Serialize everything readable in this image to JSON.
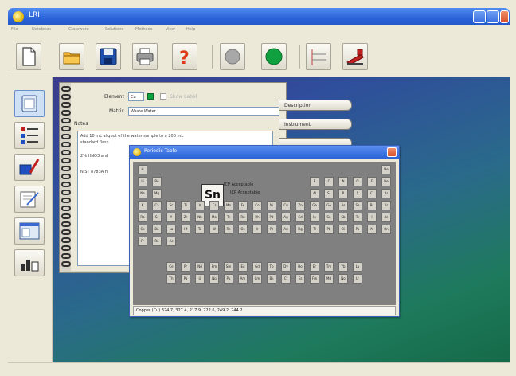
{
  "window": {
    "title": "LRI"
  },
  "menubar": [
    {
      "label": "File"
    },
    {
      "label": "Notebook"
    },
    {
      "label": "Glassware"
    },
    {
      "label": "Solutions"
    },
    {
      "label": "Methods"
    },
    {
      "label": "View"
    },
    {
      "label": "Help"
    }
  ],
  "toolbar": {
    "buttons": [
      {
        "icon": "new-document-icon"
      },
      {
        "icon": "open-folder-icon"
      },
      {
        "icon": "save-disk-icon"
      },
      {
        "icon": "printer-icon"
      },
      {
        "icon": "help-question-icon"
      },
      {
        "icon": "gray-light-icon"
      },
      {
        "icon": "green-light-icon"
      },
      {
        "icon": "notebook-lines-icon"
      },
      {
        "icon": "stapler-icon"
      }
    ]
  },
  "leftpanel": {
    "buttons": [
      {
        "icon": "notebook-icon"
      },
      {
        "icon": "list-icon"
      },
      {
        "icon": "flask-pipette-icon"
      },
      {
        "icon": "notepad-pencil-icon"
      },
      {
        "icon": "window-icon"
      },
      {
        "icon": "chart-icon"
      }
    ]
  },
  "notebook": {
    "element_label": "Element",
    "element_value": "Cu",
    "show_label": "Show Label",
    "matrix_label": "Matrix",
    "matrix_value": "Waste Water",
    "notes_label": "Notes",
    "notes_lines": [
      "Add 10 mL aliquot of the water sample to a 200 mL",
      "standard flask",
      "",
      "2% HNO3 and",
      "",
      "NIST 8783A fil"
    ]
  },
  "side_tabs": [
    {
      "label": "Description"
    },
    {
      "label": "Instrument"
    }
  ],
  "periodic_dialog": {
    "title": "Periodic Table",
    "selected_symbol": "Sn",
    "selected_info": [
      "ICP Acceptable",
      "ICP Acceptable"
    ],
    "status_text": "Copper (Cu) 324.7, 327.4, 217.9, 222.6, 249.2, 244.2",
    "rows": [
      [
        "H",
        "",
        "",
        "",
        "",
        "",
        "",
        "",
        "",
        "",
        "",
        "",
        "",
        "",
        "",
        "",
        "",
        "He"
      ],
      [
        "Li",
        "Be",
        "",
        "",
        "",
        "",
        "",
        "",
        "",
        "",
        "",
        "",
        "B",
        "C",
        "N",
        "O",
        "F",
        "Ne"
      ],
      [
        "Na",
        "Mg",
        "",
        "",
        "",
        "",
        "",
        "",
        "",
        "",
        "",
        "",
        "Al",
        "Si",
        "P",
        "S",
        "Cl",
        "Ar"
      ],
      [
        "K",
        "Ca",
        "Sc",
        "Ti",
        "V",
        "Cr",
        "Mn",
        "Fe",
        "Co",
        "Ni",
        "Cu",
        "Zn",
        "Ga",
        "Ge",
        "As",
        "Se",
        "Br",
        "Kr"
      ],
      [
        "Rb",
        "Sr",
        "Y",
        "Zr",
        "Nb",
        "Mo",
        "Tc",
        "Ru",
        "Rh",
        "Pd",
        "Ag",
        "Cd",
        "In",
        "Sn",
        "Sb",
        "Te",
        "I",
        "Xe"
      ],
      [
        "Cs",
        "Ba",
        "La",
        "Hf",
        "Ta",
        "W",
        "Re",
        "Os",
        "Ir",
        "Pt",
        "Au",
        "Hg",
        "Tl",
        "Pb",
        "Bi",
        "Po",
        "At",
        "Rn"
      ],
      [
        "Fr",
        "Ra",
        "Ac",
        "",
        "",
        "",
        "",
        "",
        "",
        "",
        "",
        "",
        "",
        "",
        "",
        "",
        "",
        ""
      ]
    ],
    "lanthanides": [
      "Ce",
      "Pr",
      "Nd",
      "Pm",
      "Sm",
      "Eu",
      "Gd",
      "Tb",
      "Dy",
      "Ho",
      "Er",
      "Tm",
      "Yb",
      "Lu"
    ],
    "actinides": [
      "Th",
      "Pa",
      "U",
      "Np",
      "Pu",
      "Am",
      "Cm",
      "Bk",
      "Cf",
      "Es",
      "Fm",
      "Md",
      "No",
      "Lr"
    ]
  }
}
